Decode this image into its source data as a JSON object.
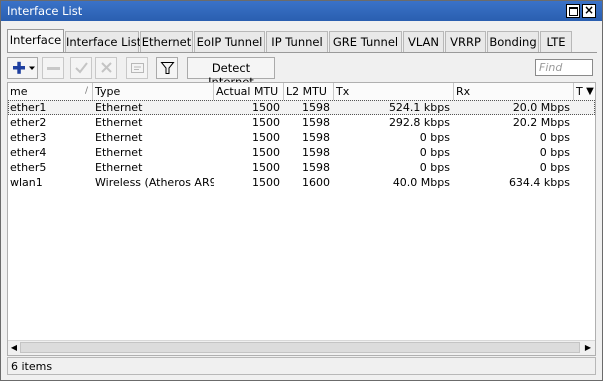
{
  "window": {
    "title": "Interface List"
  },
  "tabs": [
    {
      "label": "Interface",
      "active": true
    },
    {
      "label": "Interface List"
    },
    {
      "label": "Ethernet"
    },
    {
      "label": "EoIP Tunnel"
    },
    {
      "label": "IP Tunnel"
    },
    {
      "label": "GRE Tunnel"
    },
    {
      "label": "VLAN"
    },
    {
      "label": "VRRP"
    },
    {
      "label": "Bonding"
    },
    {
      "label": "LTE"
    }
  ],
  "toolbar": {
    "add_icon": "plus-icon",
    "remove_icon": "minus-icon",
    "enable_icon": "check-icon",
    "disable_icon": "x-icon",
    "comment_icon": "comment-icon",
    "filter_icon": "filter-icon",
    "detect_label": "Detect Internet",
    "find_placeholder": "Find"
  },
  "table": {
    "columns": [
      "me",
      "Type",
      "Actual MTU",
      "L2 MTU",
      "Tx",
      "Rx",
      "T"
    ],
    "rows": [
      {
        "name": "ether1",
        "type": "Ethernet",
        "mtu": "1500",
        "l2mtu": "1598",
        "tx": "524.1 kbps",
        "rx": "20.0 Mbps"
      },
      {
        "name": "ether2",
        "type": "Ethernet",
        "mtu": "1500",
        "l2mtu": "1598",
        "tx": "292.8 kbps",
        "rx": "20.2 Mbps"
      },
      {
        "name": "ether3",
        "type": "Ethernet",
        "mtu": "1500",
        "l2mtu": "1598",
        "tx": "0 bps",
        "rx": "0 bps"
      },
      {
        "name": "ether4",
        "type": "Ethernet",
        "mtu": "1500",
        "l2mtu": "1598",
        "tx": "0 bps",
        "rx": "0 bps"
      },
      {
        "name": "ether5",
        "type": "Ethernet",
        "mtu": "1500",
        "l2mtu": "1598",
        "tx": "0 bps",
        "rx": "0 bps"
      },
      {
        "name": "wlan1",
        "type": "Wireless (Atheros AR9...",
        "mtu": "1500",
        "l2mtu": "1600",
        "tx": "40.0 Mbps",
        "rx": "634.4 kbps"
      }
    ]
  },
  "status": {
    "text": "6 items"
  },
  "colors": {
    "titlebar": "#2f67bd",
    "add_icon": "#1e3fa0"
  }
}
